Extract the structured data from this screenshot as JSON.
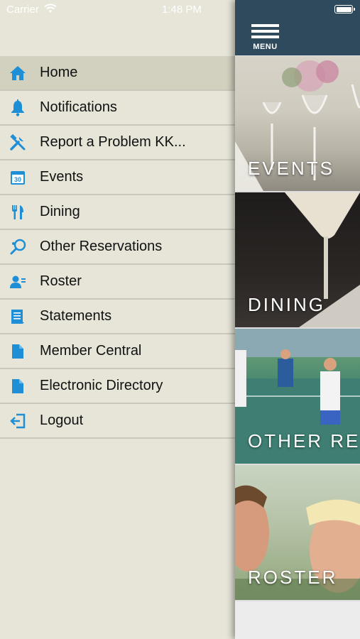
{
  "status_bar": {
    "carrier": "Carrier",
    "time": "1:48 PM"
  },
  "menu": {
    "items": [
      {
        "label": "Home",
        "icon": "home-icon",
        "active": true
      },
      {
        "label": "Notifications",
        "icon": "bell-icon"
      },
      {
        "label": "Report a Problem KK...",
        "icon": "tools-icon"
      },
      {
        "label": "Events",
        "icon": "calendar-icon"
      },
      {
        "label": "Dining",
        "icon": "utensils-icon"
      },
      {
        "label": "Other Reservations",
        "icon": "racquet-icon"
      },
      {
        "label": "Roster",
        "icon": "people-icon"
      },
      {
        "label": "Statements",
        "icon": "statement-icon"
      },
      {
        "label": "Member Central",
        "icon": "document-icon"
      },
      {
        "label": "Electronic Directory",
        "icon": "document-icon"
      },
      {
        "label": "Logout",
        "icon": "logout-icon"
      }
    ],
    "calendar_day": "30"
  },
  "header": {
    "menu_label": "MENU"
  },
  "tiles": {
    "events": "EVENTS",
    "dining": "DINING",
    "other": "OTHER RES",
    "roster": "ROSTER"
  },
  "colors": {
    "accent": "#1e8fd6",
    "topbar": "#2f4a5c",
    "drawer": "#e6e5d8",
    "active_row": "#d2d1bf"
  }
}
